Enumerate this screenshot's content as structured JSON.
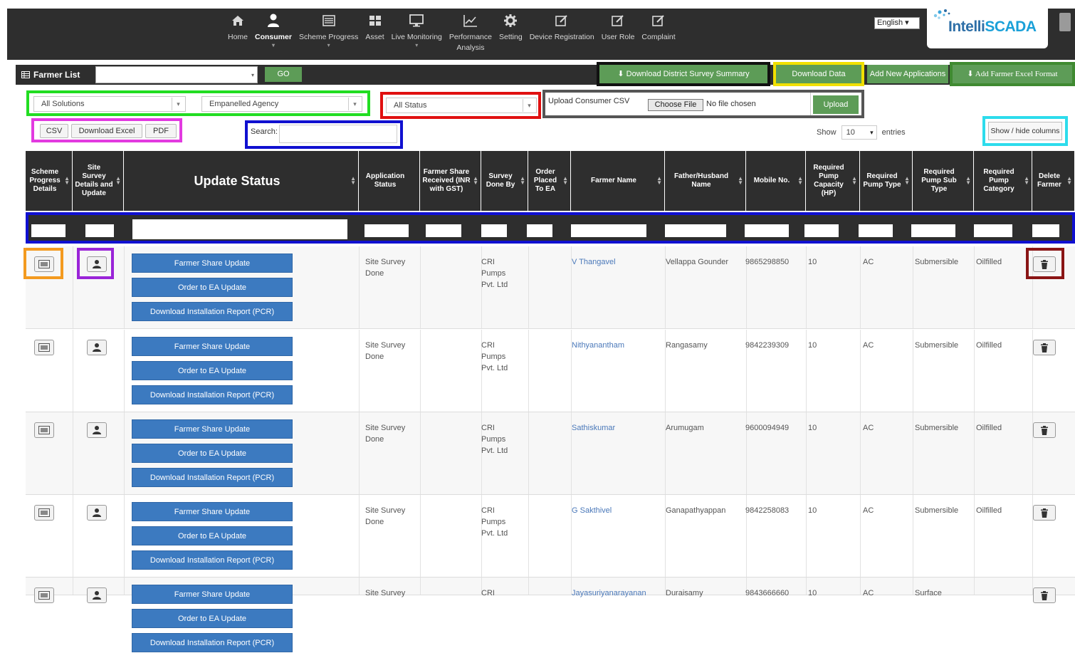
{
  "nav": [
    {
      "label": "Home",
      "icon": "home-icon"
    },
    {
      "label": "Consumer",
      "icon": "user-icon",
      "active": true
    },
    {
      "label": "Scheme Progress",
      "icon": "list-icon"
    },
    {
      "label": "Asset",
      "icon": "grid-icon"
    },
    {
      "label": "Live Monitoring",
      "icon": "monitor-icon"
    },
    {
      "label": "Performance",
      "label2": "Analysis",
      "icon": "chart-icon"
    },
    {
      "label": "Setting",
      "icon": "gear-icon"
    },
    {
      "label": "Device Registration",
      "icon": "edit-icon"
    },
    {
      "label": "User Role",
      "icon": "edit-icon"
    },
    {
      "label": "Complaint",
      "icon": "edit-icon"
    }
  ],
  "language": "English",
  "logo": {
    "text_a": "Intelli",
    "text_b": "SCADA"
  },
  "listbar": {
    "title": "Farmer List",
    "go": "GO"
  },
  "toolbar": {
    "download_summary": "Download District Survey Summary",
    "download_data": "Download Data",
    "new_applications": "Add New Applications",
    "add_excel": "Add Farmer Excel Format"
  },
  "filters": {
    "solutions": "All Solutions",
    "agency": "Empanelled Agency",
    "status": "All Status",
    "upload_label": "Upload Consumer CSV",
    "choose_file": "Choose File",
    "no_file": "No file chosen",
    "upload": "Upload"
  },
  "export": {
    "csv": "CSV",
    "excel": "Download Excel",
    "pdf": "PDF"
  },
  "search": {
    "label": "Search:"
  },
  "entries": {
    "show": "Show",
    "count": "10",
    "suffix": "entries"
  },
  "show_hide": "Show / hide columns",
  "columns": [
    "Scheme Progress Details",
    "Site Survey Details and Update",
    "Update Status",
    "Application Status",
    "Farmer Share Received (INR with GST)",
    "Survey Done By",
    "Order Placed To EA",
    "Farmer Name",
    "Father/Husband Name",
    "Mobile No.",
    "Required Pump Capacity (HP)",
    "Required Pump Type",
    "Required Pump Sub Type",
    "Required Pump Category",
    "Delete Farmer"
  ],
  "actions": {
    "farmer_share": "Farmer Share Update",
    "order_ea": "Order to EA Update",
    "download_pcr": "Download Installation Report (PCR)"
  },
  "rows": [
    {
      "app_status": "Site Survey Done",
      "survey_by": "CRI Pumps Pvt. Ltd",
      "farmer": "V Thangavel",
      "father": "Vellappa Gounder",
      "mobile": "9865298850",
      "hp": "10",
      "type": "AC",
      "subtype": "Submersible",
      "category": "Oilfilled"
    },
    {
      "app_status": "Site Survey Done",
      "survey_by": "CRI Pumps Pvt. Ltd",
      "farmer": "Nithyanantham",
      "father": "Rangasamy",
      "mobile": "9842239309",
      "hp": "10",
      "type": "AC",
      "subtype": "Submersible",
      "category": "Oilfilled"
    },
    {
      "app_status": "Site Survey Done",
      "survey_by": "CRI Pumps Pvt. Ltd",
      "farmer": "Sathiskumar",
      "father": "Arumugam",
      "mobile": "9600094949",
      "hp": "10",
      "type": "AC",
      "subtype": "Submersible",
      "category": "Oilfilled"
    },
    {
      "app_status": "Site Survey Done",
      "survey_by": "CRI Pumps Pvt. Ltd",
      "farmer": "G Sakthivel",
      "father": "Ganapathyappan",
      "mobile": "9842258083",
      "hp": "10",
      "type": "AC",
      "subtype": "Submersible",
      "category": "Oilfilled"
    },
    {
      "app_status": "Site Survey",
      "survey_by": "CRI",
      "farmer": "Jayasuriyanarayanan",
      "father": "Duraisamy",
      "mobile": "9843666660",
      "hp": "10",
      "type": "AC",
      "subtype": "Surface",
      "category": ""
    }
  ]
}
